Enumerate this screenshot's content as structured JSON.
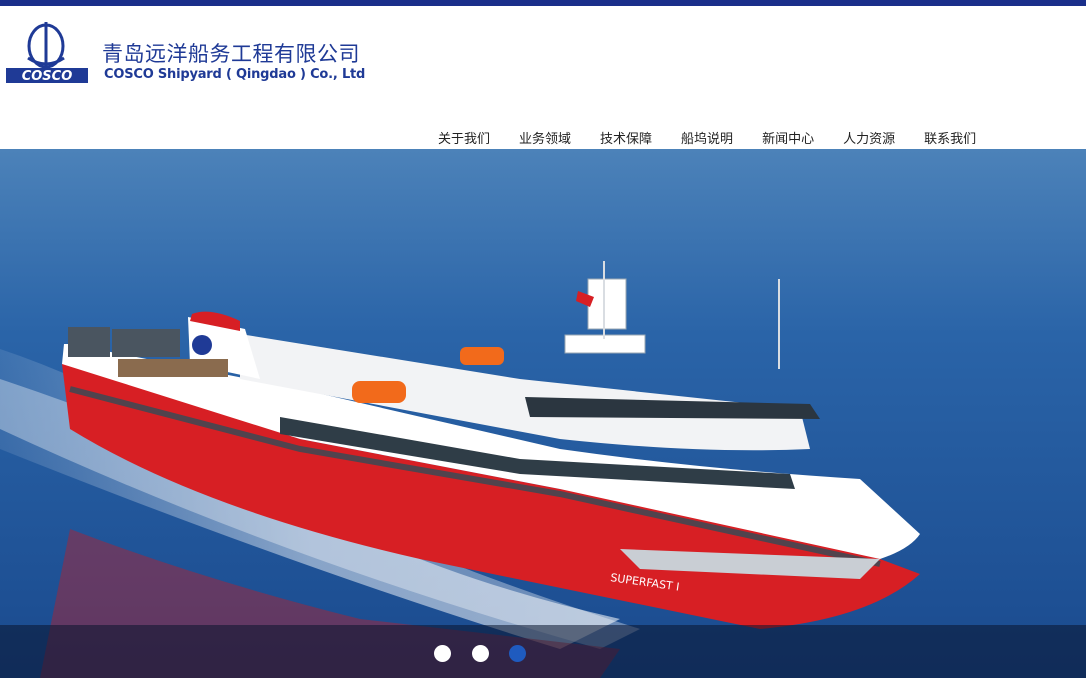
{
  "header": {
    "logo_icon": "cosco-logo-icon",
    "logo_wordmark": "COSCO",
    "brand_cn": "青岛远洋船务工程有限公司",
    "brand_en": "COSCO Shipyard ( Qingdao ) Co., Ltd",
    "accent_color": "#1a2f8a"
  },
  "nav": {
    "items": [
      "关于我们",
      "业务领域",
      "技术保障",
      "船坞说明",
      "新闻中心",
      "人力资源",
      "联系我们"
    ]
  },
  "hero": {
    "image": "ferry-ship-at-sea",
    "ship_name": "SUPERFAST I",
    "slides": 3,
    "active_slide": 3
  }
}
